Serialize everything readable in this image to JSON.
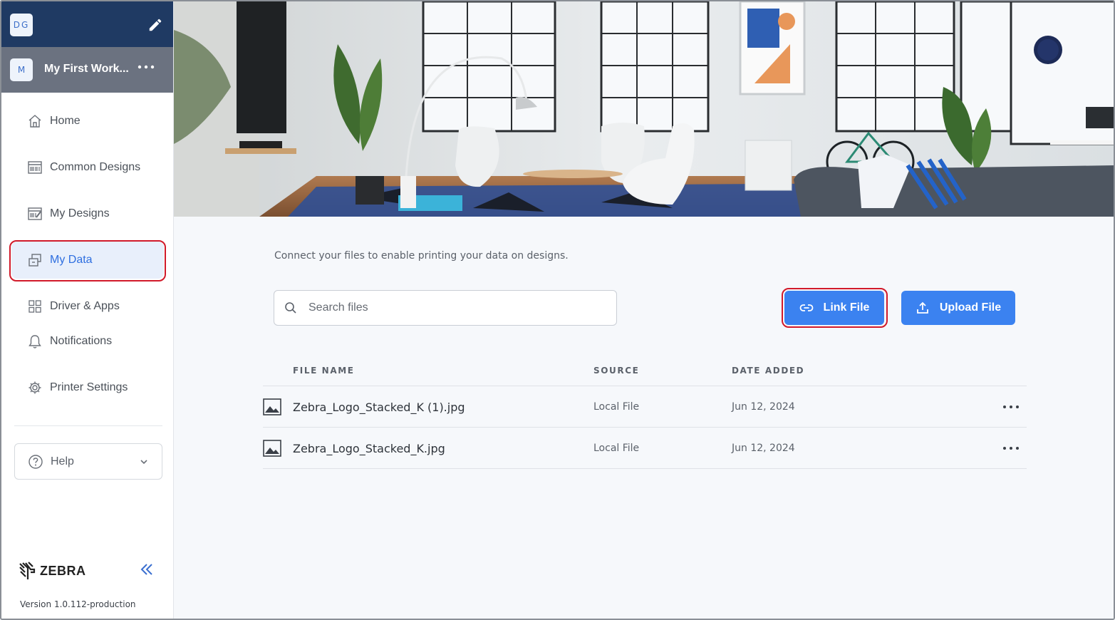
{
  "sidebar": {
    "user_initials": "DG",
    "workspace": {
      "initial": "M",
      "name": "My First Work..."
    },
    "items": [
      {
        "label": "Home",
        "icon": "home-icon"
      },
      {
        "label": "Common Designs",
        "icon": "barcode-doc-icon"
      },
      {
        "label": "My Designs",
        "icon": "design-edit-icon"
      },
      {
        "label": "My Data",
        "icon": "data-link-icon",
        "active": true
      },
      {
        "label": "Driver & Apps",
        "icon": "apps-grid-icon"
      },
      {
        "label": "Notifications",
        "icon": "bell-icon"
      },
      {
        "label": "Printer Settings",
        "icon": "gear-icon"
      }
    ],
    "help_label": "Help",
    "brand": "ZEBRA",
    "version": "Version 1.0.112-production"
  },
  "main": {
    "intro": "Connect your files to enable printing your data on designs.",
    "search_placeholder": "Search files",
    "link_file_label": "Link File",
    "upload_file_label": "Upload File",
    "columns": [
      "FILE NAME",
      "SOURCE",
      "DATE ADDED"
    ],
    "files": [
      {
        "name": "Zebra_Logo_Stacked_K (1).jpg",
        "source": "Local File",
        "date": "Jun 12, 2024"
      },
      {
        "name": "Zebra_Logo_Stacked_K.jpg",
        "source": "Local File",
        "date": "Jun 12, 2024"
      }
    ]
  },
  "colors": {
    "accent": "#3b82f0",
    "topbar": "#1f3a63",
    "workspace_bar": "#6b7280",
    "highlight": "#d11a2a"
  }
}
